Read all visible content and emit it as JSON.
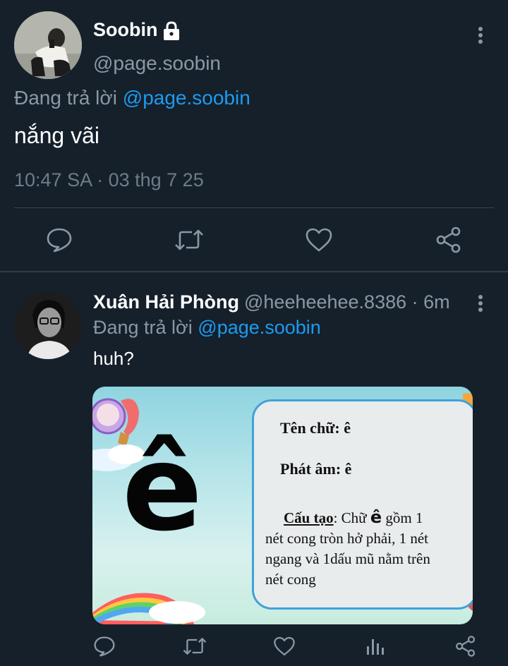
{
  "main_tweet": {
    "author_name": "Soobin",
    "author_handle": "@page.soobin",
    "reply_prefix": "Đang trả lời",
    "reply_to": "@page.soobin",
    "text": "nắng vãi",
    "timestamp": "10:47 SA · 03 thg 7 25"
  },
  "reply_tweet": {
    "author_name": "Xuân Hải Phòng",
    "meta": "@heeheehee.8386 · 6m",
    "reply_prefix": "Đang trả lời",
    "reply_to": "@page.soobin",
    "text": "huh?",
    "media": {
      "big_letter": "ê",
      "name_label": "Tên chữ: ê",
      "sound_label": "Phát âm: ê",
      "structure_label": "Cấu tạo",
      "structure_text_a": ": Chữ ",
      "structure_letter": "ê",
      "structure_text_b": " gồm 1",
      "line2": "nét cong tròn hở phải,  1 nét",
      "line3": "ngang và 1dấu mũ nằm trên",
      "line4": "nét cong"
    }
  },
  "colors": {
    "background": "#15202b",
    "mention": "#1d9bf0",
    "secondary_text": "#8b98a5",
    "icon": "#8b98a5"
  },
  "icons": {
    "lock": "lock-icon",
    "more": "more-vertical-icon",
    "reply": "comment-icon",
    "retweet": "retweet-icon",
    "like": "heart-icon",
    "share": "share-icon",
    "views": "bar-chart-icon"
  }
}
